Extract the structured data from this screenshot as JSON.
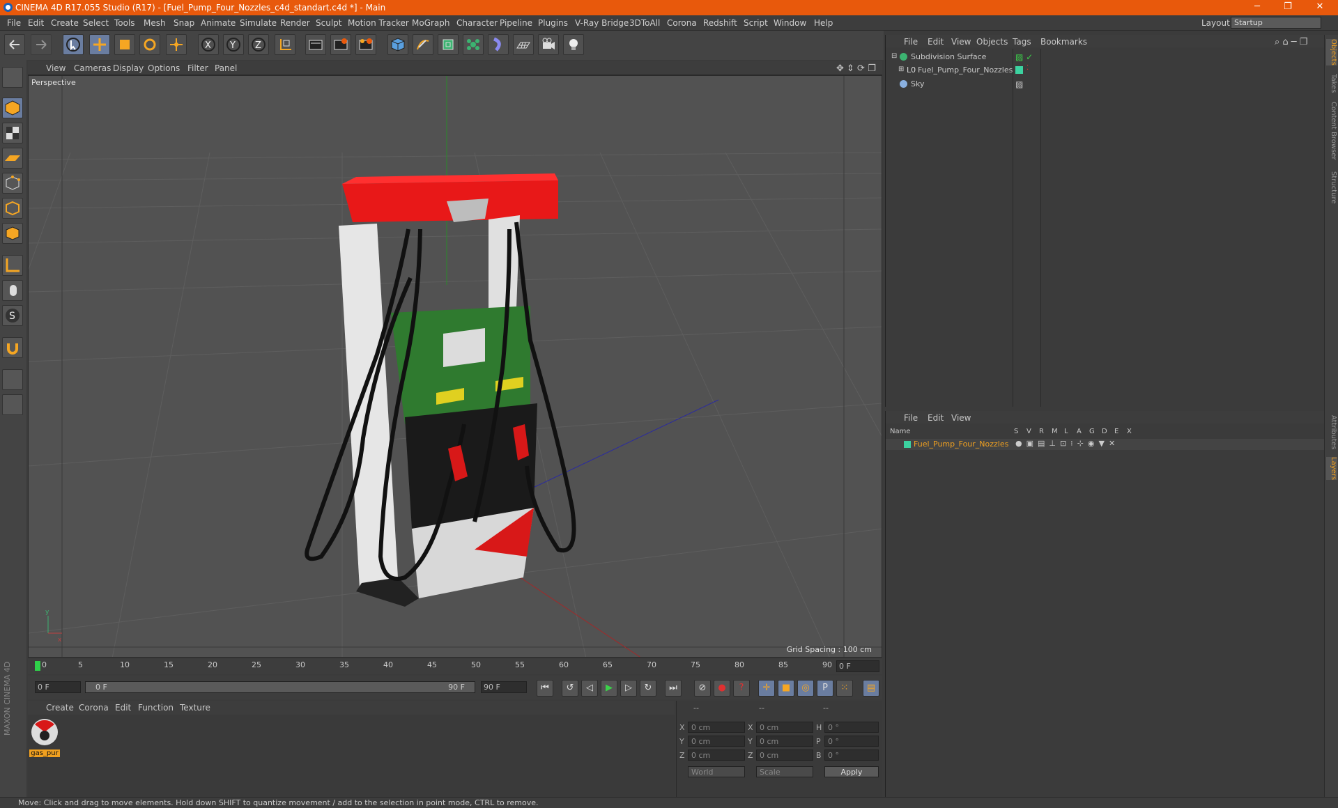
{
  "window": {
    "title": "CINEMA 4D R17.055 Studio (R17) - [Fuel_Pump_Four_Nozzles_c4d_standart.c4d *] - Main",
    "minimize": "─",
    "restore": "❐",
    "close": "✕"
  },
  "menu": [
    "File",
    "Edit",
    "Create",
    "Select",
    "Tools",
    "Mesh",
    "Snap",
    "Animate",
    "Simulate",
    "Render",
    "Sculpt",
    "Motion Tracker",
    "MoGraph",
    "Character",
    "Pipeline",
    "Plugins",
    "V-Ray Bridge",
    "3DToAll",
    "Corona",
    "Redshift",
    "Script",
    "Window",
    "Help"
  ],
  "layout": {
    "label": "Layout:",
    "value": "Startup"
  },
  "viewport": {
    "menu": [
      "View",
      "Cameras",
      "Display",
      "Options",
      "Filter",
      "Panel"
    ],
    "label": "Perspective",
    "grid_spacing": "Grid Spacing : 100 cm"
  },
  "timeline": {
    "ticks": [
      "0",
      "5",
      "10",
      "15",
      "20",
      "25",
      "30",
      "35",
      "40",
      "45",
      "50",
      "55",
      "60",
      "65",
      "70",
      "75",
      "80",
      "85",
      "90"
    ],
    "current_frame": "0 F"
  },
  "transport": {
    "start": "0 F",
    "slider_start": "0 F",
    "slider_end": "90 F",
    "end": "90 F"
  },
  "materials": {
    "menu": [
      "Create",
      "Corona",
      "Edit",
      "Function",
      "Texture"
    ],
    "items": [
      {
        "name": "gas_pur"
      }
    ]
  },
  "coords": {
    "header": [
      "--",
      "--",
      "--"
    ],
    "rows": [
      {
        "a": "X",
        "av": "0 cm",
        "b": "X",
        "bv": "0 cm",
        "c": "H",
        "cv": "0 °"
      },
      {
        "a": "Y",
        "av": "0 cm",
        "b": "Y",
        "bv": "0 cm",
        "c": "P",
        "cv": "0 °"
      },
      {
        "a": "Z",
        "av": "0 cm",
        "b": "Z",
        "bv": "0 cm",
        "c": "B",
        "cv": "0 °"
      }
    ],
    "world": "World",
    "scale": "Scale",
    "apply": "Apply"
  },
  "objects": {
    "menu": [
      "File",
      "Edit",
      "View",
      "Objects",
      "Tags",
      "Bookmarks"
    ],
    "items": [
      {
        "name": "Subdivision Surface",
        "color": "#c8c8c8"
      },
      {
        "name": "Fuel_Pump_Four_Nozzles",
        "color": "#c8c8c8"
      },
      {
        "name": "Sky",
        "color": "#c8c8c8"
      }
    ]
  },
  "layers": {
    "menu": [
      "File",
      "Edit",
      "View"
    ],
    "columns": [
      "Name",
      "S",
      "V",
      "R",
      "M",
      "L",
      "A",
      "G",
      "D",
      "E",
      "X"
    ],
    "items": [
      {
        "name": "Fuel_Pump_Four_Nozzles",
        "color": "#f0a020"
      }
    ]
  },
  "right_tabs": [
    "Objects",
    "Takes",
    "Content Browser",
    "Structure",
    "Attributes",
    "Layers"
  ],
  "status": "Move: Click and drag to move elements. Hold down SHIFT to quantize movement / add to the selection in point mode, CTRL to remove.",
  "brand": "MAXON CINEMA 4D"
}
